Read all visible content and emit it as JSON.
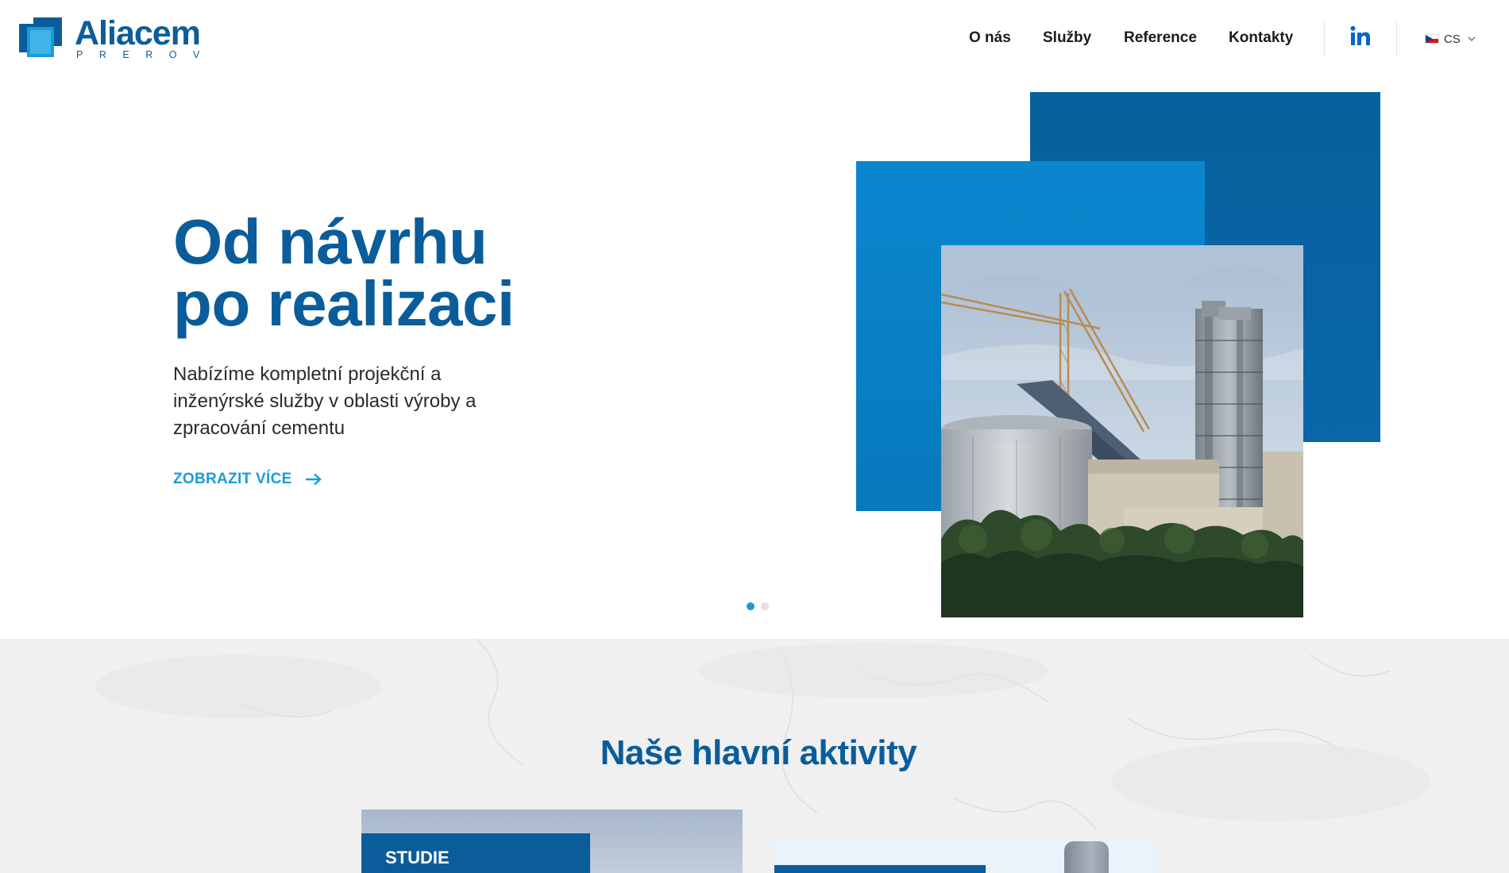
{
  "header": {
    "logo": {
      "name": "Aliacem",
      "subtitle": "PREROV"
    },
    "nav": [
      {
        "label": "O nás"
      },
      {
        "label": "Služby"
      },
      {
        "label": "Reference"
      },
      {
        "label": "Kontakty"
      }
    ],
    "social_icon": "linkedin-icon",
    "language": {
      "code": "CS",
      "flag": "czech-flag-icon"
    }
  },
  "hero": {
    "title_line1": "Od návrhu",
    "title_line2": "po realizaci",
    "description": "Nabízíme kompletní projekční a inženýrské služby v oblasti výroby a zpracování cementu",
    "cta_label": "ZOBRAZIT VÍCE",
    "slides_total": 2,
    "slide_active": 1
  },
  "activities": {
    "title": "Naše hlavní aktivity",
    "cards": [
      {
        "label": "STUDIE"
      },
      {
        "label": ""
      }
    ]
  },
  "colors": {
    "brand_dark": "#0a5d9a",
    "brand_mid": "#0a82c9",
    "accent": "#1b9bd7",
    "section_bg": "#f0f0f0"
  }
}
